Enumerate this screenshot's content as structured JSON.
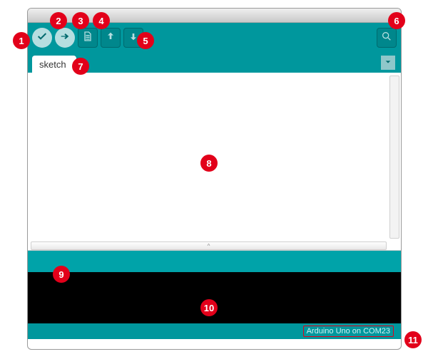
{
  "tab": {
    "label": "sketch"
  },
  "footer": {
    "board_port": "Arduino Uno on COM23"
  },
  "toolbar": {
    "verify_icon": "check-icon",
    "upload_icon": "arrow-right-icon",
    "new_icon": "file-icon",
    "open_icon": "arrow-up-icon",
    "save_icon": "arrow-down-icon",
    "serial_icon": "magnifier-icon"
  },
  "annotations": {
    "a1": "1",
    "a2": "2",
    "a3": "3",
    "a4": "4",
    "a5": "5",
    "a6": "6",
    "a7": "7",
    "a8": "8",
    "a9": "9",
    "a10": "10",
    "a11": "11"
  },
  "colors": {
    "teal": "#00979d",
    "teal_dark": "#00878c",
    "red": "#e2001a"
  }
}
